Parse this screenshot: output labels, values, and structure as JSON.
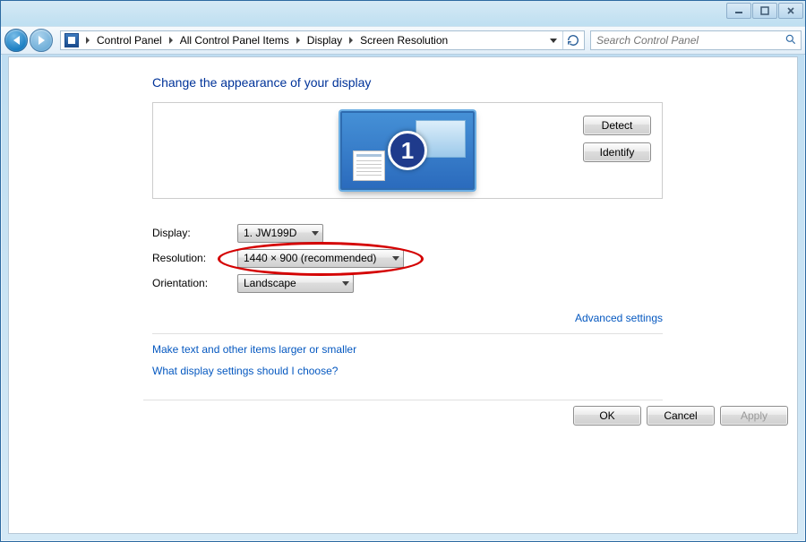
{
  "breadcrumb": {
    "items": [
      "Control Panel",
      "All Control Panel Items",
      "Display",
      "Screen Resolution"
    ]
  },
  "search": {
    "placeholder": "Search Control Panel"
  },
  "page": {
    "title": "Change the appearance of your display"
  },
  "monitor": {
    "number": "1"
  },
  "panel_buttons": {
    "detect": "Detect",
    "identify": "Identify"
  },
  "form": {
    "display_label": "Display:",
    "display_value": "1. JW199D",
    "resolution_label": "Resolution:",
    "resolution_value": "1440 × 900 (recommended)",
    "orientation_label": "Orientation:",
    "orientation_value": "Landscape"
  },
  "links": {
    "advanced": "Advanced settings",
    "text_larger": "Make text and other items larger or smaller",
    "which_settings": "What display settings should I choose?"
  },
  "buttons": {
    "ok": "OK",
    "cancel": "Cancel",
    "apply": "Apply"
  }
}
